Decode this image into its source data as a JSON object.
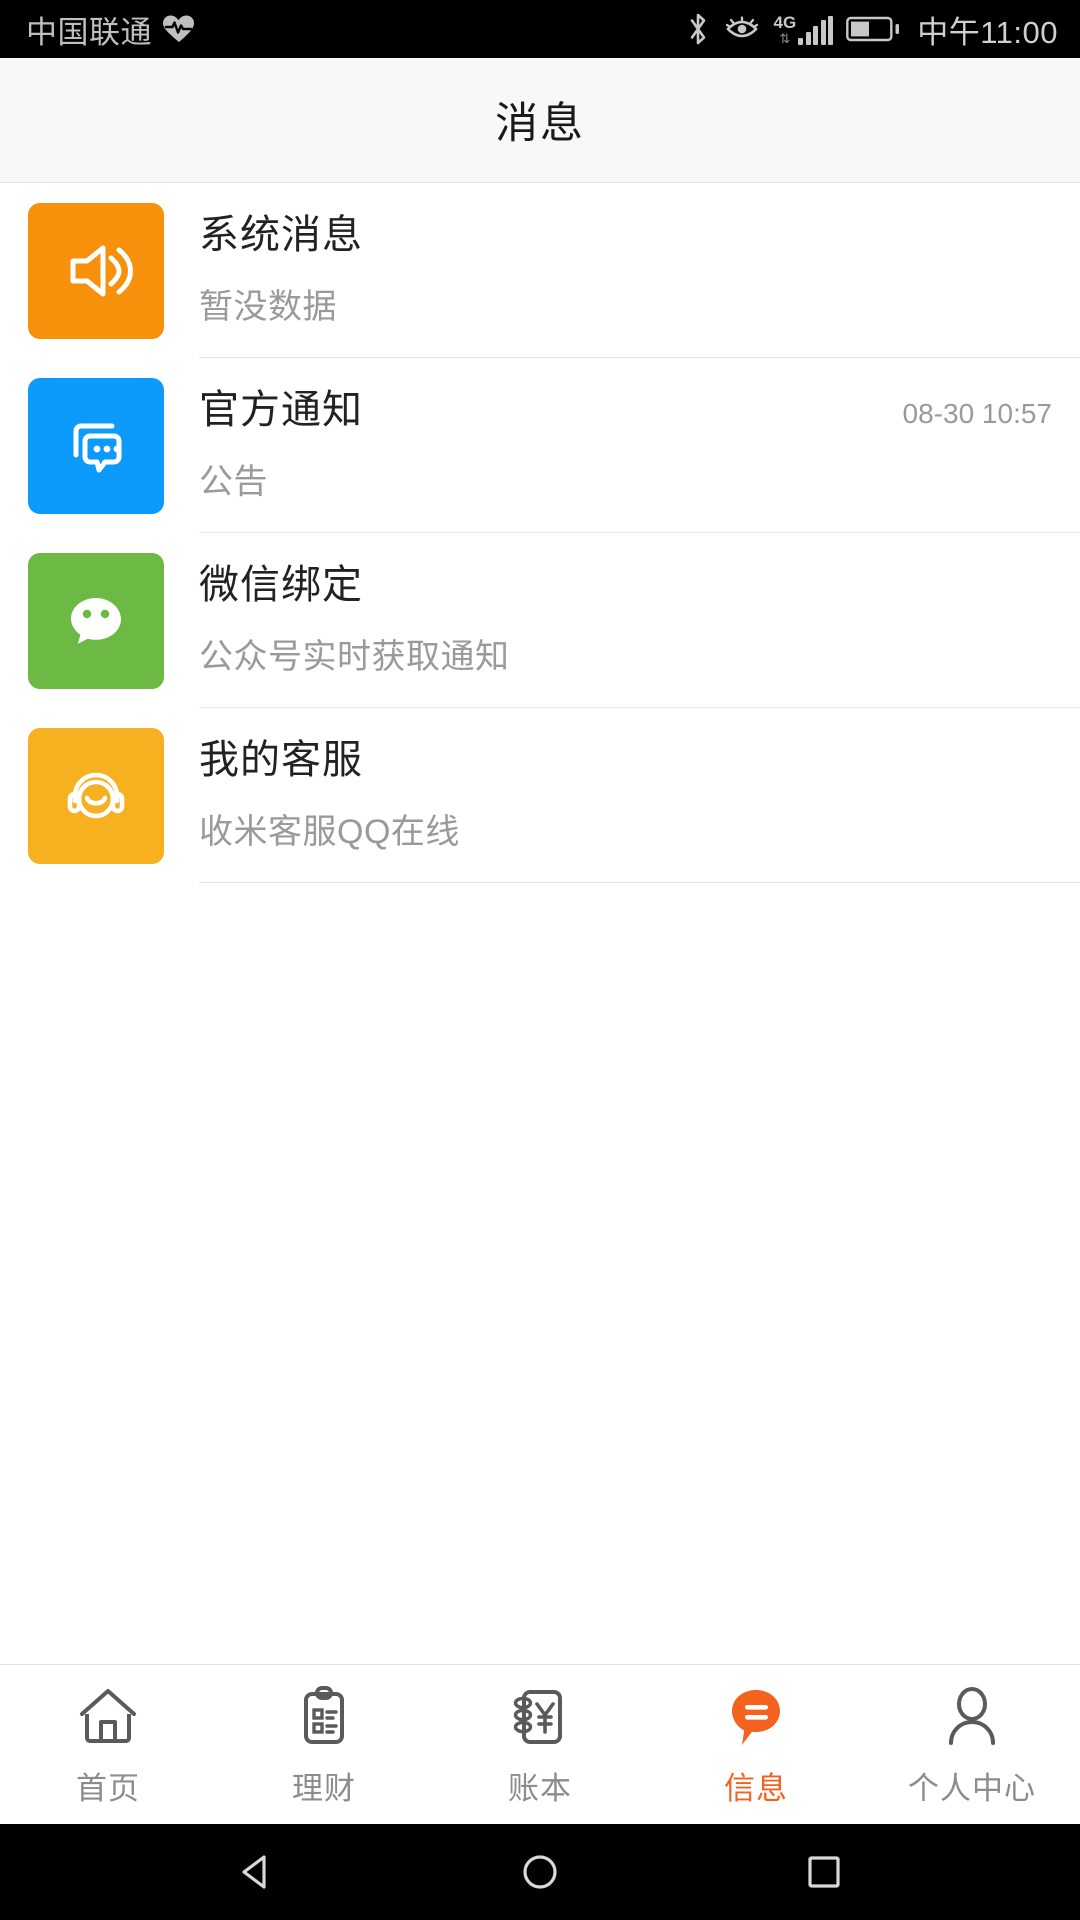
{
  "statusbar": {
    "carrier": "中国联通",
    "health_icon": "heartbeat-icon",
    "bluetooth_icon": "bluetooth-icon",
    "eye_icon": "eye-comfort-icon",
    "network_label": "4G",
    "network_arrows": "⇅",
    "signal_icon": "signal-bars-icon",
    "battery_icon": "battery-icon",
    "time": "中午11:00"
  },
  "header": {
    "title": "消息"
  },
  "messages": [
    {
      "icon": "speaker-icon",
      "icon_color": "#f7900a",
      "title": "系统消息",
      "subtitle": "暂没数据",
      "time": ""
    },
    {
      "icon": "chat-bubbles-icon",
      "icon_color": "#0d9bfb",
      "title": "官方通知",
      "subtitle": "公告",
      "time": "08-30 10:57"
    },
    {
      "icon": "wechat-icon",
      "icon_color": "#6cb943",
      "title": "微信绑定",
      "subtitle": "公众号实时获取通知",
      "time": ""
    },
    {
      "icon": "headset-support-icon",
      "icon_color": "#f7b01f",
      "title": "我的客服",
      "subtitle": "收米客服QQ在线",
      "time": ""
    }
  ],
  "tabbar": {
    "active_color": "#f4631e",
    "inactive_color": "#8c8c8c",
    "items": [
      {
        "icon": "home-icon",
        "label": "首页",
        "active": false
      },
      {
        "icon": "clipboard-icon",
        "label": "理财",
        "active": false
      },
      {
        "icon": "ledger-yen-icon",
        "label": "账本",
        "active": false
      },
      {
        "icon": "message-bubble-icon",
        "label": "信息",
        "active": true
      },
      {
        "icon": "person-icon",
        "label": "个人中心",
        "active": false
      }
    ]
  },
  "navbar": {
    "back_icon": "triangle-back-icon",
    "home_icon": "circle-home-icon",
    "recents_icon": "square-recents-icon"
  }
}
